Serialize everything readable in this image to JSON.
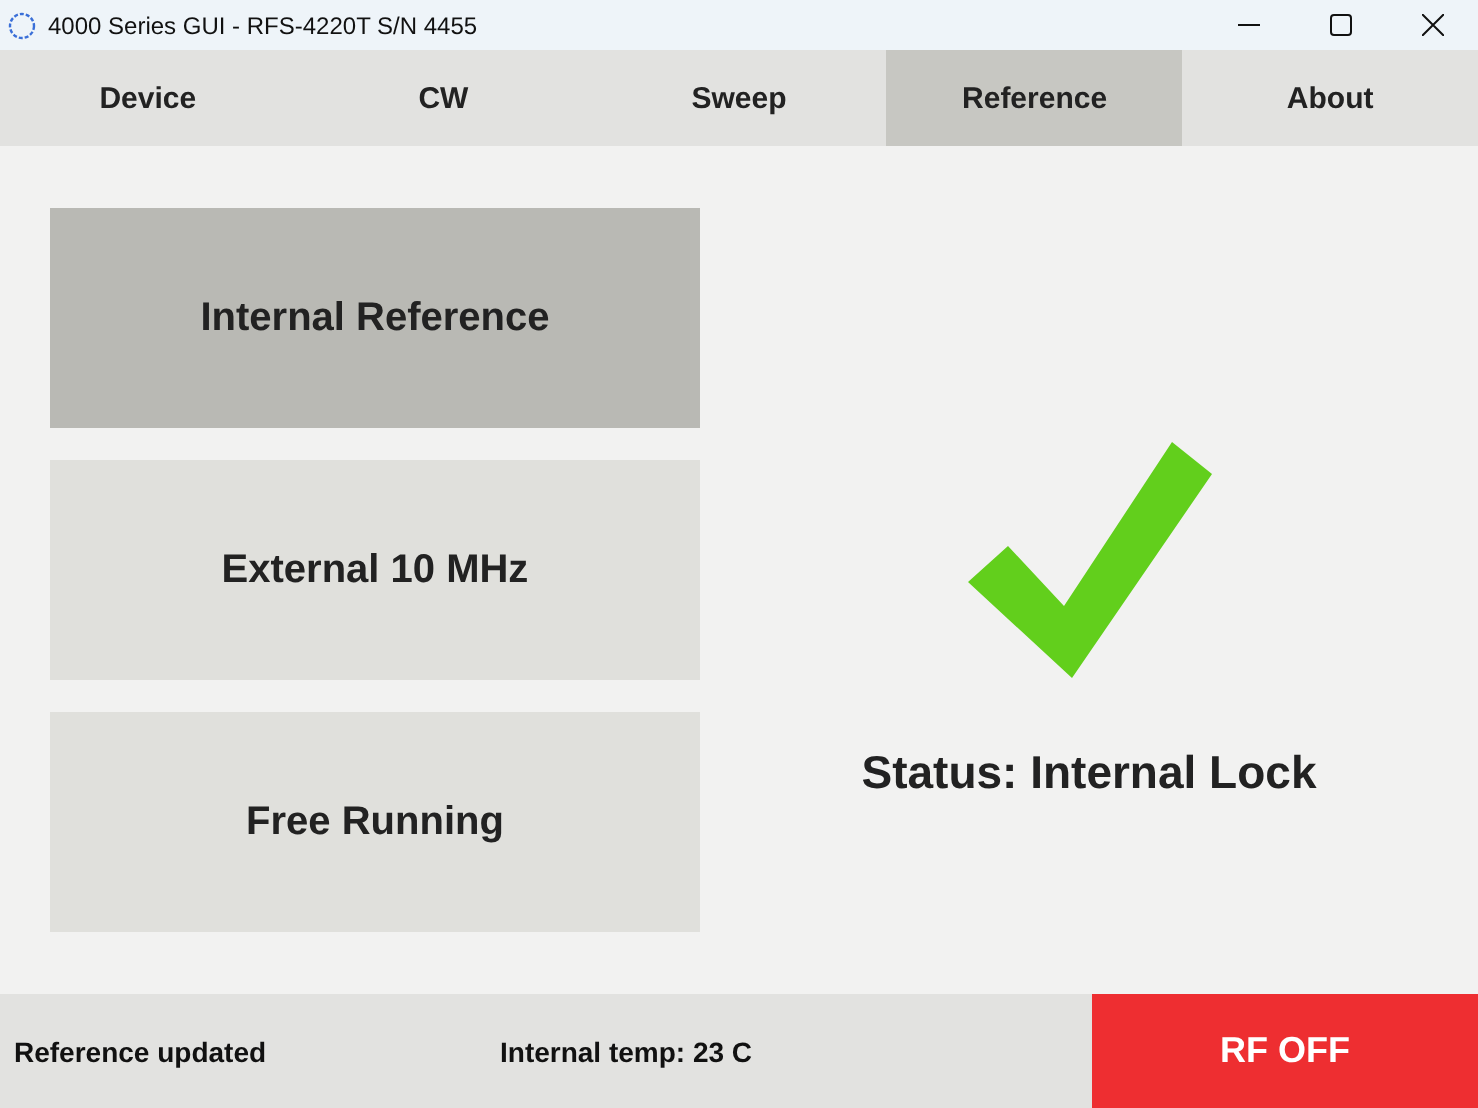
{
  "window": {
    "title": "4000 Series GUI - RFS-4220T S/N 4455"
  },
  "tabs": [
    {
      "label": "Device",
      "selected": false
    },
    {
      "label": "CW",
      "selected": false
    },
    {
      "label": "Sweep",
      "selected": false
    },
    {
      "label": "Reference",
      "selected": true
    },
    {
      "label": "About",
      "selected": false
    }
  ],
  "reference_options": [
    {
      "label": "Internal Reference",
      "selected": true
    },
    {
      "label": "External 10 MHz",
      "selected": false
    },
    {
      "label": "Free Running",
      "selected": false
    }
  ],
  "status": {
    "locked": true,
    "text": "Status: Internal Lock"
  },
  "status_bar": {
    "message": "Reference updated",
    "temperature": "Internal temp: 23 C",
    "rf_button": {
      "label": "RF OFF",
      "on": false
    }
  }
}
